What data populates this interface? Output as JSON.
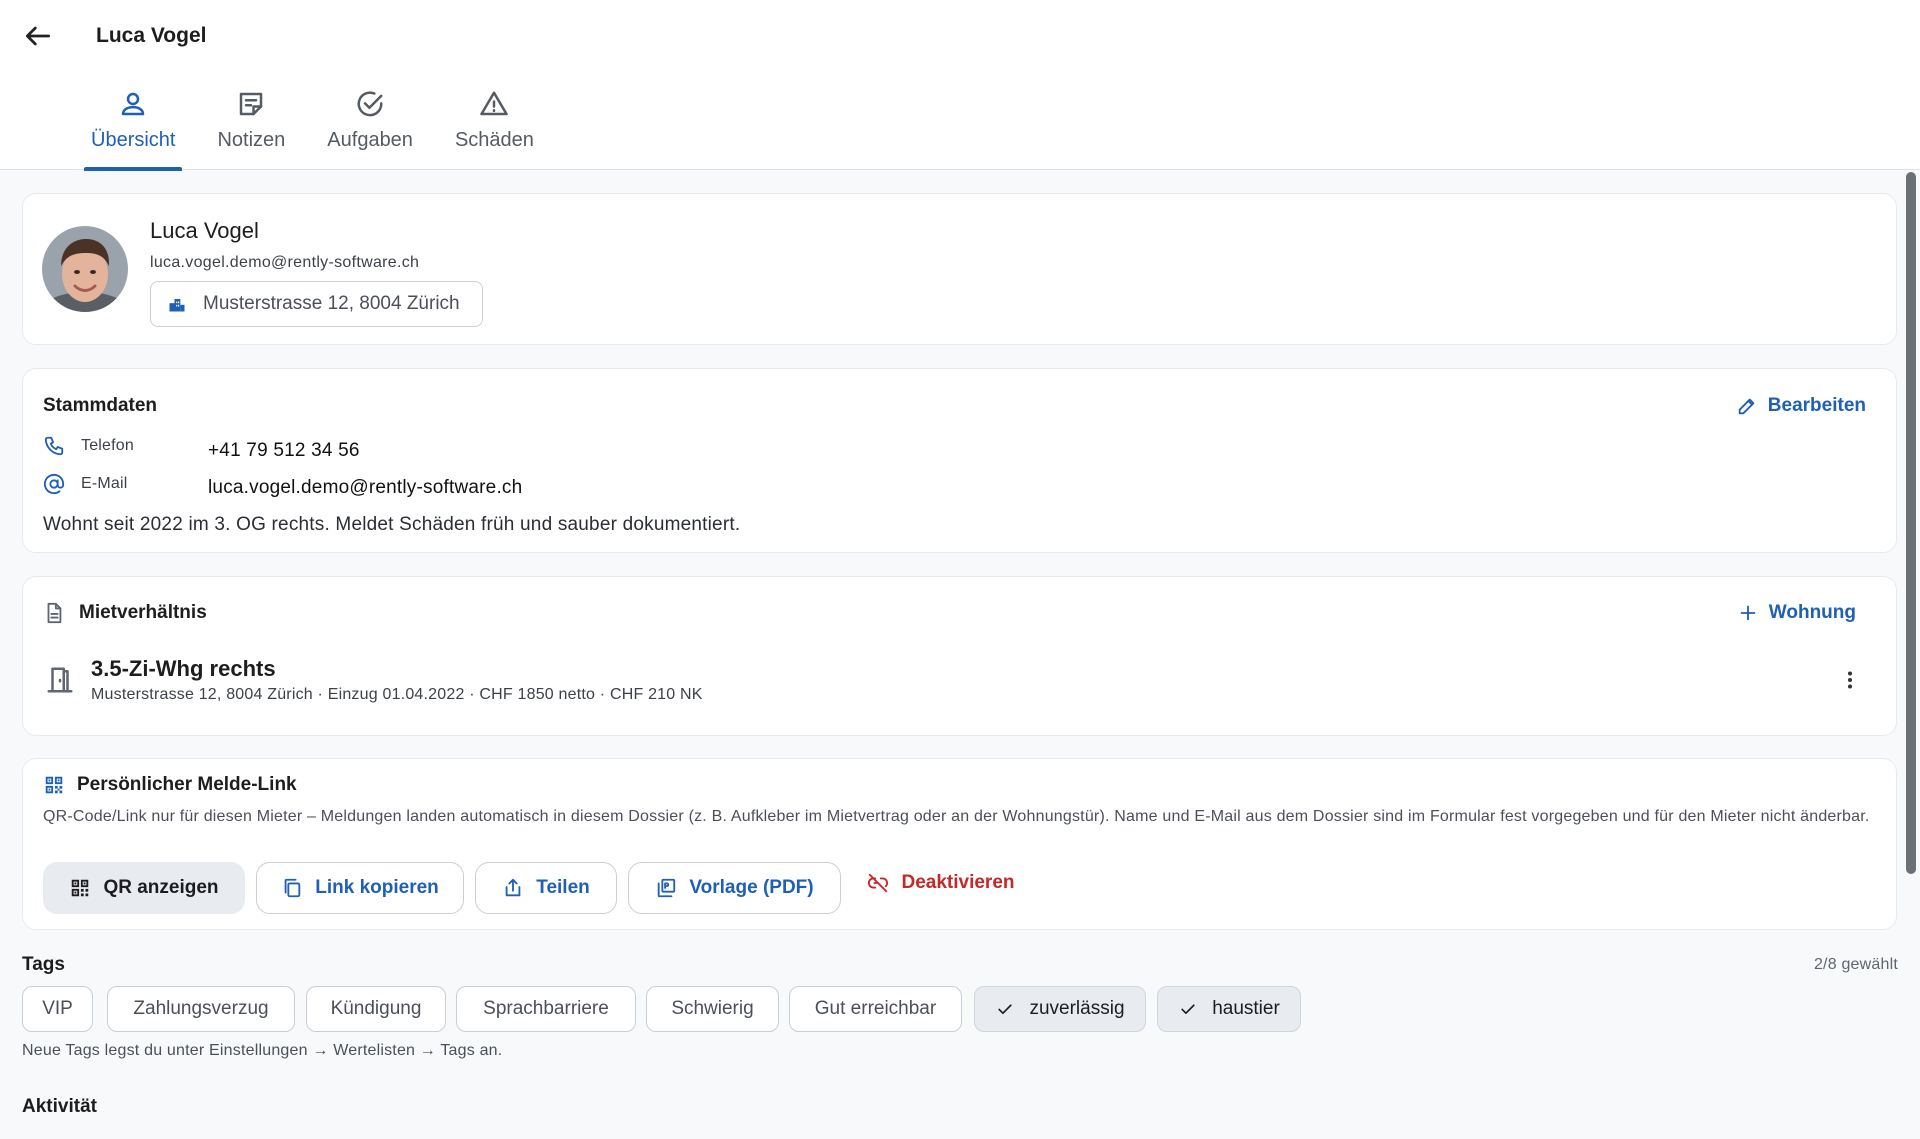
{
  "header": {
    "back_icon": "arrow-left-icon",
    "title": "Luca Vogel",
    "tabs": [
      {
        "label": "Übersicht",
        "icon": "person-icon",
        "active": true
      },
      {
        "label": "Notizen",
        "icon": "note-icon",
        "active": false
      },
      {
        "label": "Aufgaben",
        "icon": "check-circle-icon",
        "active": false
      },
      {
        "label": "Schäden",
        "icon": "warning-icon",
        "active": false
      }
    ]
  },
  "profile": {
    "name": "Luca Vogel",
    "email": "luca.vogel.demo@rently-software.ch",
    "address": "Musterstrasse 12, 8004 Zürich"
  },
  "stammdaten": {
    "title": "Stammdaten",
    "edit_label": "Bearbeiten",
    "phone_label": "Telefon",
    "phone_value": "+41 79 512 34 56",
    "email_label": "E-Mail",
    "email_value": "luca.vogel.demo@rently-software.ch",
    "note": "Wohnt seit 2022 im 3. OG rechts. Meldet Schäden früh und sauber dokumentiert."
  },
  "mietverhaeltnis": {
    "title": "Mietverhältnis",
    "add_label": "Wohnung",
    "unit_title": "3.5-Zi-Whg rechts",
    "unit_meta": "Musterstrasse 12, 8004 Zürich · Einzug 01.04.2022 · CHF 1850 netto · CHF 210 NK"
  },
  "melde_link": {
    "title": "Persönlicher Melde-Link",
    "description": "QR-Code/Link nur für diesen Mieter – Meldungen landen automatisch in diesem Dossier (z. B. Aufkleber im Mietvertrag oder an der Wohnungstür). Name und E-Mail aus dem Dossier sind im Formular fest vorgegeben und für den Mieter nicht änderbar.",
    "actions": {
      "qr": "QR anzeigen",
      "copy": "Link kopieren",
      "share": "Teilen",
      "pdf": "Vorlage (PDF)",
      "deactivate": "Deaktivieren"
    }
  },
  "tags": {
    "title": "Tags",
    "count": "2/8 gewählt",
    "items": [
      {
        "label": "VIP",
        "selected": false
      },
      {
        "label": "Zahlungsverzug",
        "selected": false
      },
      {
        "label": "Kündigung",
        "selected": false
      },
      {
        "label": "Sprachbarriere",
        "selected": false
      },
      {
        "label": "Schwierig",
        "selected": false
      },
      {
        "label": "Gut erreichbar",
        "selected": false
      },
      {
        "label": "zuverlässig",
        "selected": true
      },
      {
        "label": "haustier",
        "selected": true
      }
    ],
    "hint": "Neue Tags legst du unter Einstellungen → Wertelisten → Tags an."
  },
  "activity": {
    "title": "Aktivität"
  },
  "colors": {
    "accent": "#1f5fb5",
    "danger": "#c62828",
    "background": "#f8f9fb",
    "chip_selected": "#e8ebf0"
  }
}
